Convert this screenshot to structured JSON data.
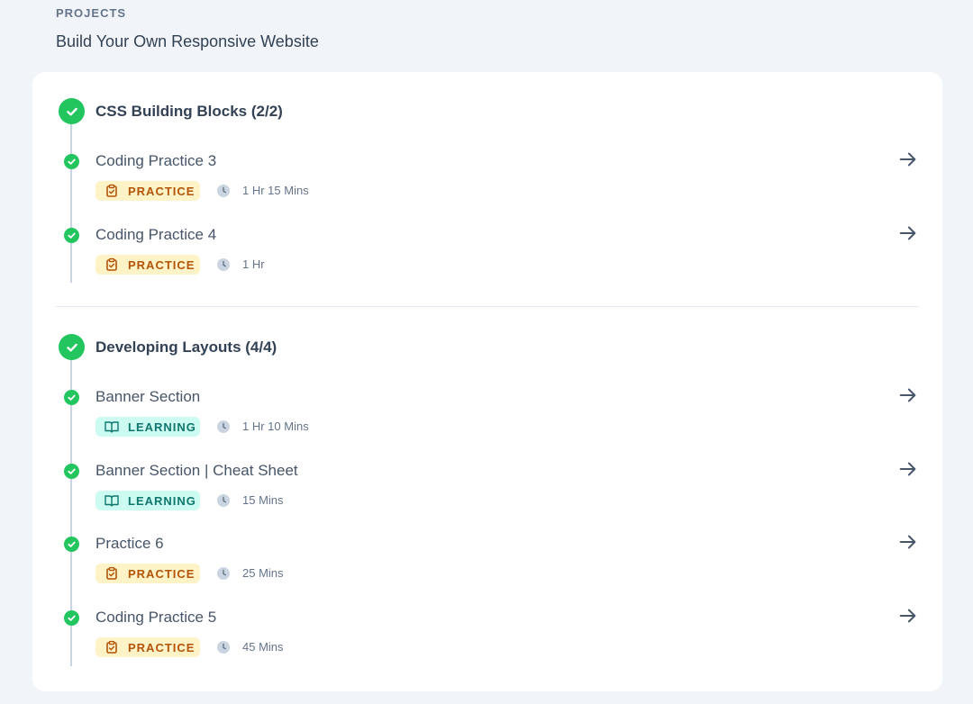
{
  "header": {
    "eyebrow": "PROJECTS",
    "title": "Build Your Own Responsive Website"
  },
  "sections": [
    {
      "title": "CSS Building Blocks (2/2)",
      "items": [
        {
          "title": "Coding Practice 3",
          "badge": "PRACTICE",
          "duration": "1 Hr 15 Mins"
        },
        {
          "title": "Coding Practice 4",
          "badge": "PRACTICE",
          "duration": "1 Hr"
        }
      ]
    },
    {
      "title": "Developing Layouts (4/4)",
      "items": [
        {
          "title": "Banner Section",
          "badge": "LEARNING",
          "duration": "1 Hr 10 Mins"
        },
        {
          "title": "Banner Section | Cheat Sheet",
          "badge": "LEARNING",
          "duration": "15 Mins"
        },
        {
          "title": "Practice 6",
          "badge": "PRACTICE",
          "duration": "25 Mins"
        },
        {
          "title": "Coding Practice 5",
          "badge": "PRACTICE",
          "duration": "45 Mins"
        }
      ]
    }
  ],
  "icons": {
    "completed": "check-circle-icon",
    "open": "arrow-right-icon",
    "practice": "clipboard-check-icon",
    "learning": "book-open-icon",
    "duration": "clock-icon"
  },
  "colors": {
    "success": "#22c55e",
    "practice_bg": "#fef3c7",
    "practice_text": "#b45309",
    "learning_bg": "#ccfbf1",
    "learning_text": "#0f766e"
  }
}
